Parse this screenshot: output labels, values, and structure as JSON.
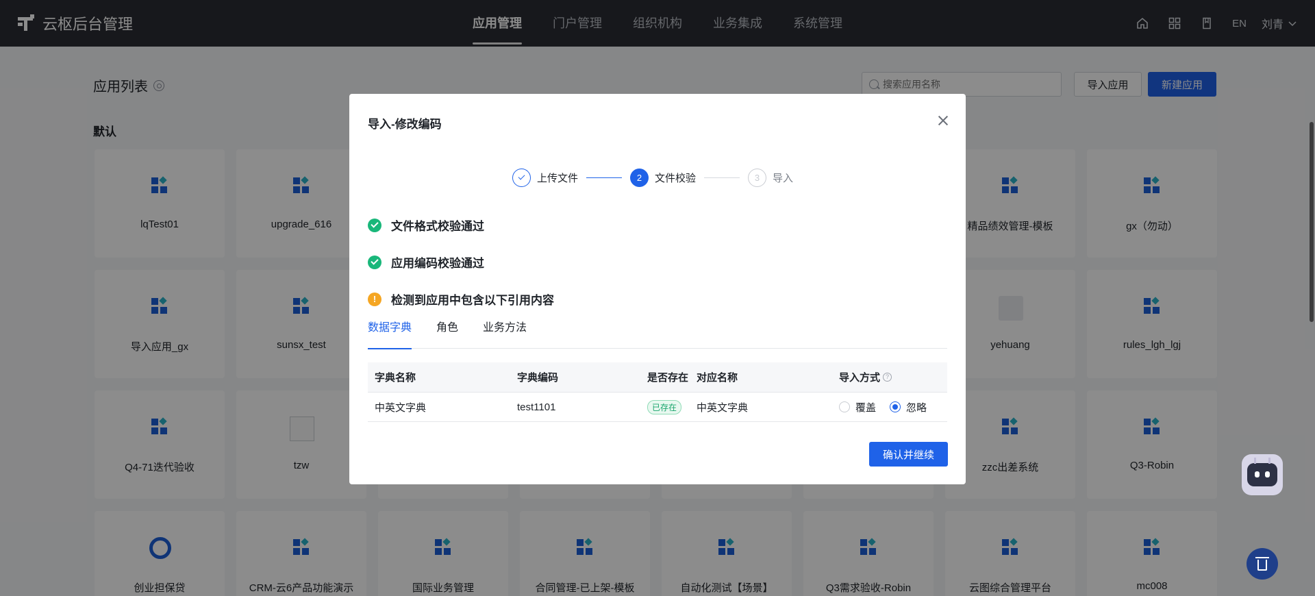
{
  "brand": {
    "name": "云枢后台管理"
  },
  "nav": {
    "items": [
      {
        "label": "应用管理",
        "active": true
      },
      {
        "label": "门户管理"
      },
      {
        "label": "组织机构"
      },
      {
        "label": "业务集成"
      },
      {
        "label": "系统管理"
      }
    ],
    "lang": "EN",
    "user": "刘青"
  },
  "page": {
    "title": "应用列表",
    "search_placeholder": "搜索应用名称",
    "import_label": "导入应用",
    "new_label": "新建应用",
    "group_title": "默认"
  },
  "apps": [
    {
      "name": "lqTest01",
      "icon": "grid"
    },
    {
      "name": "upgrade_616",
      "icon": "grid"
    },
    {
      "name": "",
      "icon": "grid"
    },
    {
      "name": "",
      "icon": "grid"
    },
    {
      "name": "",
      "icon": "grid"
    },
    {
      "name": "",
      "icon": "grid"
    },
    {
      "name": "精品绩效管理-模板",
      "icon": "grid"
    },
    {
      "name": "gx（勿动）",
      "icon": "grid"
    },
    {
      "name": "导入应用_gx",
      "icon": "grid"
    },
    {
      "name": "sunsx_test",
      "icon": "grid"
    },
    {
      "name": "",
      "icon": "grid"
    },
    {
      "name": "",
      "icon": "grid"
    },
    {
      "name": "",
      "icon": "grid"
    },
    {
      "name": "",
      "icon": "grid"
    },
    {
      "name": "yehuang",
      "icon": "grey"
    },
    {
      "name": "rules_lgh_lgj",
      "icon": "grid"
    },
    {
      "name": "Q4-71迭代验收",
      "icon": "grid"
    },
    {
      "name": "tzw",
      "icon": "img"
    },
    {
      "name": "",
      "icon": "grid"
    },
    {
      "name": "",
      "icon": "grid"
    },
    {
      "name": "",
      "icon": "grid"
    },
    {
      "name": "",
      "icon": "grid"
    },
    {
      "name": "zzc出差系统",
      "icon": "grid"
    },
    {
      "name": "Q3-Robin",
      "icon": "grid"
    },
    {
      "name": "创业担保贷",
      "icon": "ring"
    },
    {
      "name": "CRM-云6产品功能演示",
      "icon": "grid"
    },
    {
      "name": "国际业务管理",
      "icon": "grid"
    },
    {
      "name": "合同管理-已上架-模板",
      "icon": "grid"
    },
    {
      "name": "自动化测试【场景】",
      "icon": "grid"
    },
    {
      "name": "Q3需求验收-Robin",
      "icon": "grid"
    },
    {
      "name": "云图综合管理平台",
      "icon": "grid"
    },
    {
      "name": "mc008",
      "icon": "grid"
    }
  ],
  "modal": {
    "title": "导入-修改编码",
    "steps": [
      {
        "num": "",
        "label": "上传文件",
        "state": "done"
      },
      {
        "num": "2",
        "label": "文件校验",
        "state": "current"
      },
      {
        "num": "3",
        "label": "导入",
        "state": "next"
      }
    ],
    "checks": [
      {
        "text": "文件格式校验通过",
        "status": "ok"
      },
      {
        "text": "应用编码校验通过",
        "status": "ok"
      },
      {
        "text": "检测到应用中包含以下引用内容",
        "status": "warn",
        "symbol": "!"
      }
    ],
    "tabs": [
      {
        "label": "数据字典",
        "active": true
      },
      {
        "label": "角色"
      },
      {
        "label": "业务方法"
      }
    ],
    "table": {
      "headers": [
        "字典名称",
        "字典编码",
        "是否存在",
        "对应名称",
        "导入方式"
      ],
      "help_symbol": "?",
      "rows": [
        {
          "name": "中英文字典",
          "code": "test1101",
          "exists": "已存在",
          "target": "中英文字典",
          "options": [
            "覆盖",
            "忽略"
          ],
          "selected": "忽略"
        }
      ]
    },
    "confirm_label": "确认并继续"
  }
}
